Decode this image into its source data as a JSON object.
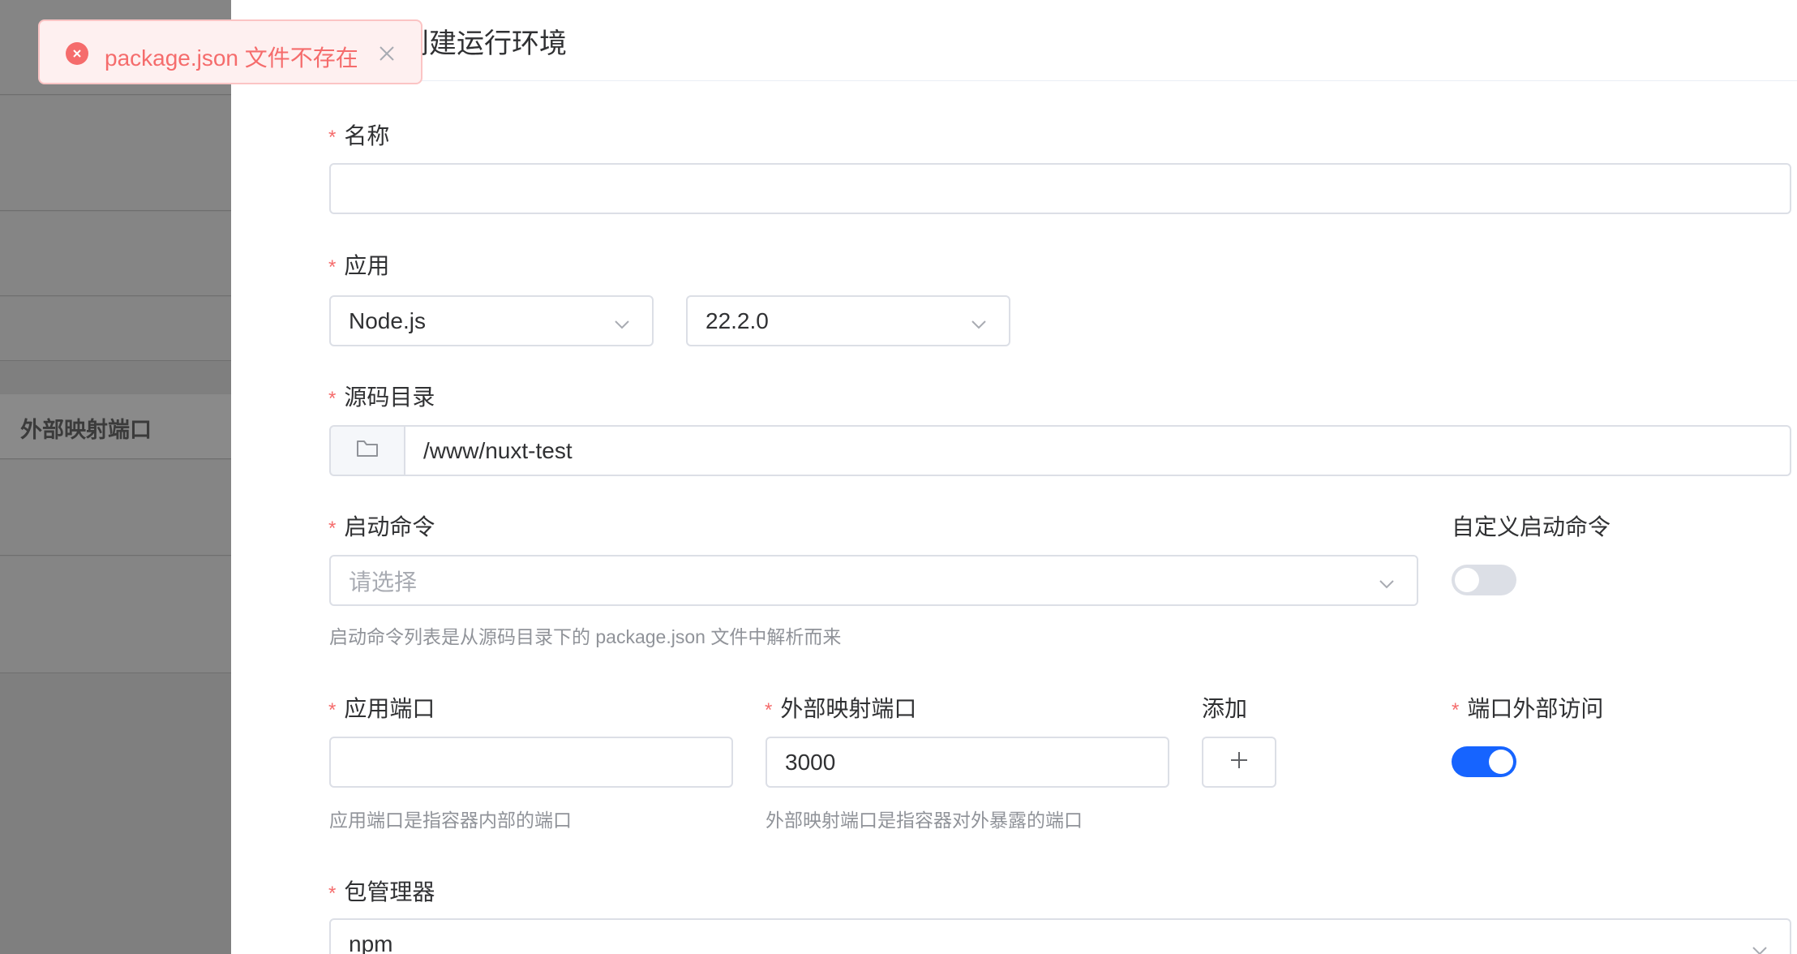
{
  "background": {
    "column_label": "外部映射端口"
  },
  "toast": {
    "message": "package.json 文件不存在",
    "type": "error"
  },
  "drawer": {
    "title": "创建运行环境"
  },
  "form": {
    "name": {
      "label": "名称",
      "required": true,
      "value": ""
    },
    "app": {
      "label": "应用",
      "required": true,
      "app_value": "Node.js",
      "version_value": "22.2.0"
    },
    "source_dir": {
      "label": "源码目录",
      "required": true,
      "value": "/www/nuxt-test"
    },
    "start_cmd": {
      "label": "启动命令",
      "required": true,
      "placeholder": "请选择",
      "help": "启动命令列表是从源码目录下的 package.json 文件中解析而来"
    },
    "custom_cmd": {
      "label": "自定义启动命令",
      "enabled": false
    },
    "app_port": {
      "label": "应用端口",
      "required": true,
      "value": "",
      "help": "应用端口是指容器内部的端口"
    },
    "external_port": {
      "label": "外部映射端口",
      "required": true,
      "value": "3000",
      "help": "外部映射端口是指容器对外暴露的端口"
    },
    "add": {
      "label": "添加"
    },
    "port_external_access": {
      "label": "端口外部访问",
      "required": true,
      "enabled": true
    },
    "package_manager": {
      "label": "包管理器",
      "required": true,
      "value": "npm"
    }
  },
  "colors": {
    "accent": "#1664ff",
    "error": "#f56c6c",
    "required_mark": "#f56c6c"
  }
}
